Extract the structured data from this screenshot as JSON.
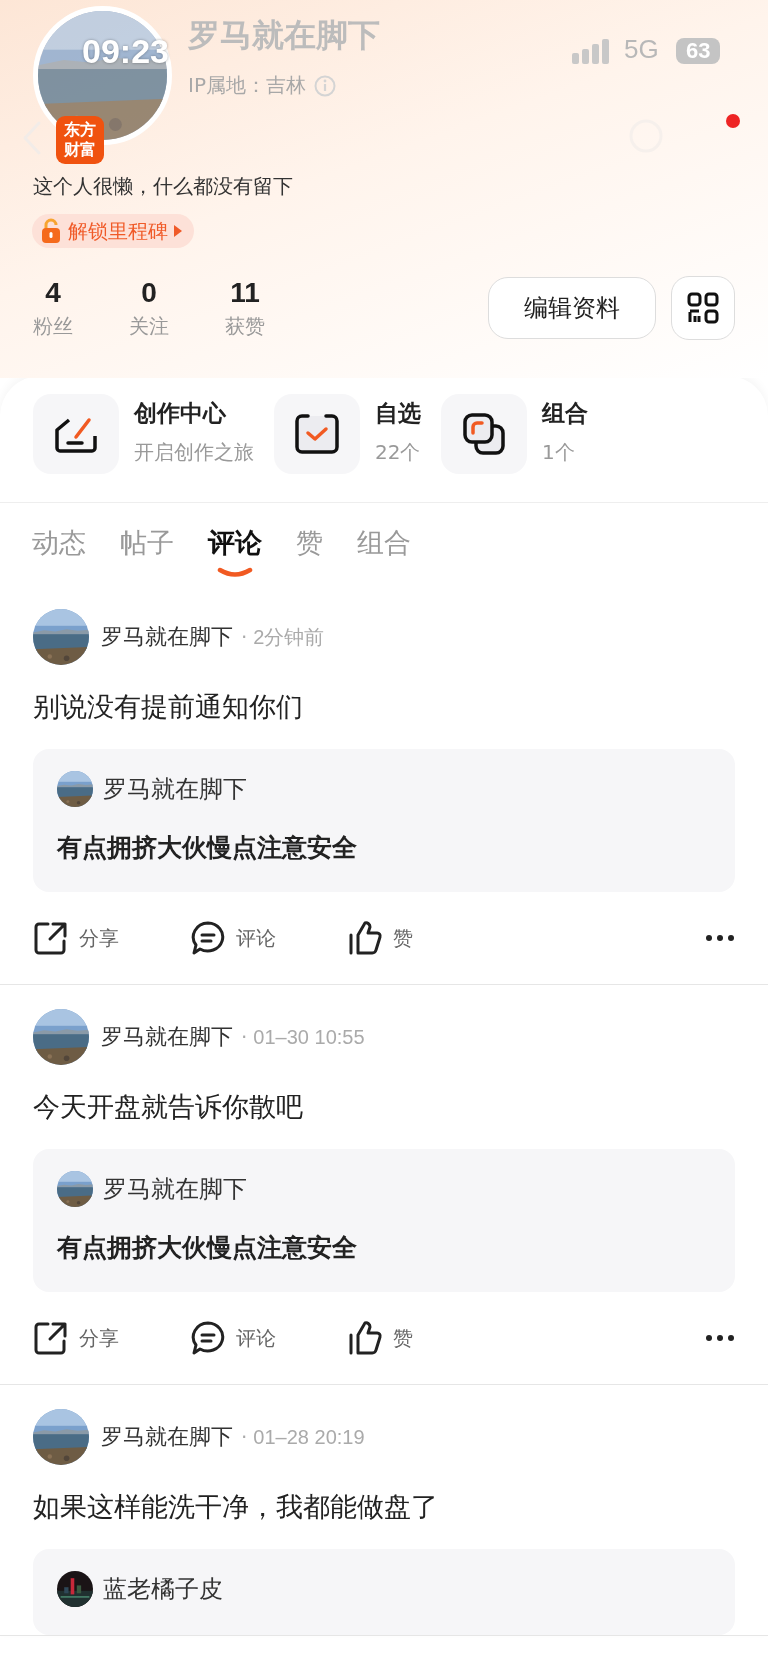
{
  "status_bar": {
    "time": "09:23",
    "network": "5G",
    "battery": "63"
  },
  "profile": {
    "name": "罗马就在脚下",
    "ip_location": "IP属地：吉林",
    "badge_lines": [
      "东方",
      "财富"
    ],
    "bio": "这个人很懒，什么都没有留下",
    "milestone": "解锁里程碑"
  },
  "stats": [
    {
      "value": "4",
      "label": "粉丝"
    },
    {
      "value": "0",
      "label": "关注"
    },
    {
      "value": "11",
      "label": "获赞"
    }
  ],
  "edit_button": "编辑资料",
  "shortcuts": [
    {
      "kind": "create",
      "title": "创作中心",
      "subtitle": "开启创作之旅"
    },
    {
      "kind": "watchlist",
      "title": "自选",
      "subtitle": "22个"
    },
    {
      "kind": "portfolio",
      "title": "组合",
      "subtitle": "1个"
    }
  ],
  "tabs": [
    {
      "label": "动态",
      "selected": false
    },
    {
      "label": "帖子",
      "selected": false
    },
    {
      "label": "评论",
      "selected": true
    },
    {
      "label": "赞",
      "selected": false
    },
    {
      "label": "组合",
      "selected": false
    }
  ],
  "posts": [
    {
      "author": "罗马就在脚下",
      "separator": "·",
      "time": "2分钟前",
      "text": "别说没有提前通知你们",
      "quote": {
        "author": "罗马就在脚下",
        "text": "有点拥挤大伙慢点注意安全"
      },
      "actions": [
        {
          "kind": "share",
          "label": "分享"
        },
        {
          "kind": "comment",
          "label": "评论"
        },
        {
          "kind": "like",
          "label": "赞"
        }
      ]
    },
    {
      "author": "罗马就在脚下",
      "separator": "·",
      "time": "01–30 10:55",
      "text": "今天开盘就告诉你散吧",
      "quote": {
        "author": "罗马就在脚下",
        "text": "有点拥挤大伙慢点注意安全"
      },
      "actions": [
        {
          "kind": "share",
          "label": "分享"
        },
        {
          "kind": "comment",
          "label": "评论"
        },
        {
          "kind": "like",
          "label": "赞"
        }
      ]
    },
    {
      "author": "罗马就在脚下",
      "separator": "·",
      "time": "01–28 20:19",
      "text": "如果这样能洗干净，我都能做盘了",
      "quote": {
        "author": "蓝老橘子皮"
      }
    }
  ]
}
